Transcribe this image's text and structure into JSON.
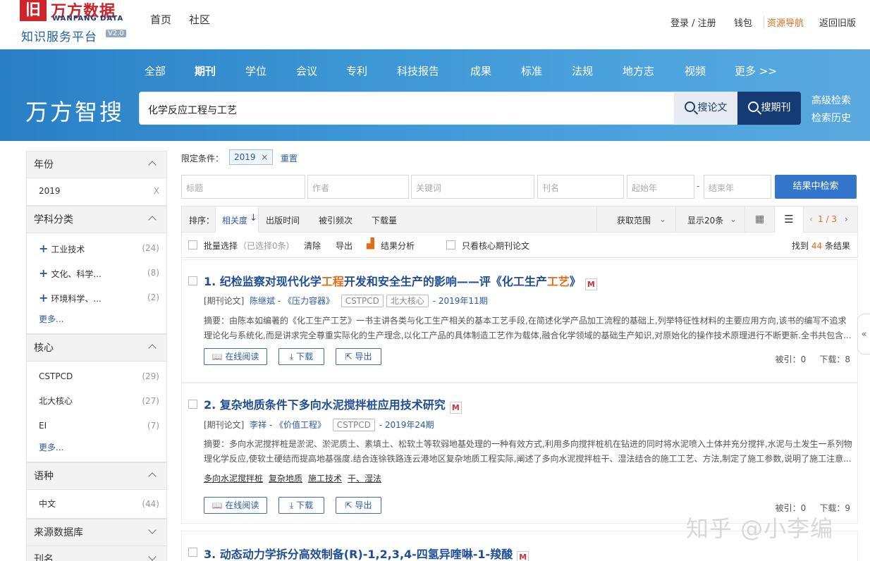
{
  "header": {
    "logo_mark": "旧",
    "logo_cn": "万方数据",
    "logo_en": "WANFANG DATA",
    "platform": "知识服务平台",
    "version": "V2.0",
    "nav": [
      "首页",
      "社区"
    ],
    "login": "登录 / 注册",
    "wallet": "钱包",
    "resource_nav": "资源导航",
    "old_version": "返回旧版"
  },
  "banner": {
    "brand": "万方智搜",
    "categories": [
      "全部",
      "期刊",
      "学位",
      "会议",
      "专利",
      "科技报告",
      "成果",
      "标准",
      "法规",
      "地方志",
      "视频",
      "更多 >>"
    ],
    "search_value": "化学反应工程与工艺",
    "search_papers": "搜论文",
    "search_journals": "搜期刊",
    "advanced": "高级检索",
    "history": "检索历史"
  },
  "sidebar": {
    "year": {
      "title": "年份",
      "items": [
        {
          "label": "2019",
          "count": "X"
        }
      ]
    },
    "subject": {
      "title": "学科分类",
      "items": [
        {
          "label": "工业技术",
          "count": "(24)"
        },
        {
          "label": "文化、科学...",
          "count": "(8)"
        },
        {
          "label": "环境科学、...",
          "count": "(2)"
        }
      ],
      "more": "更多..."
    },
    "core": {
      "title": "核心",
      "items": [
        {
          "label": "CSTPCD",
          "count": "(29)"
        },
        {
          "label": "北大核心",
          "count": "(27)"
        },
        {
          "label": "EI",
          "count": "(7)"
        }
      ],
      "more": "更多..."
    },
    "language": {
      "title": "语种",
      "items": [
        {
          "label": "中文",
          "count": "(44)"
        }
      ]
    },
    "source": {
      "title": "来源数据库"
    },
    "journal": {
      "title": "刊名"
    }
  },
  "filters": {
    "label": "限定条件：",
    "chip": "2019",
    "chip_close": "×",
    "reset": "重置",
    "fields": [
      "标题",
      "作者",
      "关键词",
      "刊名",
      "起始年",
      "结束年"
    ],
    "dash": "-",
    "refine": "结果中检索"
  },
  "sort": {
    "label": "排序：",
    "options": [
      "相关度",
      "出版时间",
      "被引频次",
      "下载量"
    ],
    "range": "获取范围",
    "per_page": "显示20条",
    "page": "1 / 3"
  },
  "actions": {
    "batch": "批量选择",
    "selected": "（已选择0条）",
    "clear": "清除",
    "export": "导出",
    "analysis": "结果分析",
    "core_only": "只看核心期刊论文",
    "found_prefix": "找到",
    "found_count": "44",
    "found_suffix": "条结果"
  },
  "results": [
    {
      "num": "1.",
      "title_a": "纪检监察对现代化学",
      "title_h1": "工程",
      "title_b": "开发和安全生产的影响——评《化工生产",
      "title_h2": "工艺",
      "title_c": "》",
      "type": "[期刊论文]",
      "author": "陈继斌",
      "journal": "《压力容器》",
      "tags": [
        "CSTPCD",
        "北大核心"
      ],
      "date": "2019年11期",
      "abs_line1": "摘要：由陈本如编著的《化工生产工艺》一书主讲各类与化工生产相关的基本工艺手段,在简述化学产品加工流程的基础上,列举特征性材料的主要应用方向,该书的编写不追求",
      "abs_line2": "理论化与系统化,而是讲求完全尊重实际化的生产理念,以化工产品的具体制造工艺作为载体,融合化学领域的基础生产知识,对原始化的操作技术原理进行不断更新.全书共包含...",
      "read": "在线阅读",
      "download": "下载",
      "export": "导出",
      "cite": "被引：0",
      "downloads": "下载：8"
    },
    {
      "num": "2.",
      "title": "复杂地质条件下多向水泥搅拌桩应用技术研究",
      "type": "[期刊论文]",
      "author": "李祥",
      "journal": "《价值工程》",
      "tags": [
        "CSTPCD"
      ],
      "date": "2019年24期",
      "abs_line1": "摘要：多向水泥搅拌桩是淤泥、淤泥质土、素填土、松软土等软弱地基处理的一种有效方式,利用多向搅拌桩机在钻进的同时将水泥喷入土体并充分搅拌,水泥与土发生一系列物",
      "abs_line2": "理化学反应,使软土硬结而提高地基强度.结合连徐铁路连云港地区复杂地质工程实际,阐述了多向水泥搅拌桩干、湿法结合的施工工艺、方法,制定了施工参数,说明了施工注意...",
      "keywords": [
        "多向水泥搅拌桩",
        "复杂地质",
        "施工技术",
        "干、湿法"
      ],
      "read": "在线阅读",
      "download": "下载",
      "export": "导出",
      "cite": "被引：0",
      "downloads": "下载：9"
    },
    {
      "num": "3.",
      "title": "动态动力学拆分高效制备(R)-1,2,3,4-四氢异喹啉-1-羧酸"
    }
  ],
  "watermark": "知乎 @小李编"
}
